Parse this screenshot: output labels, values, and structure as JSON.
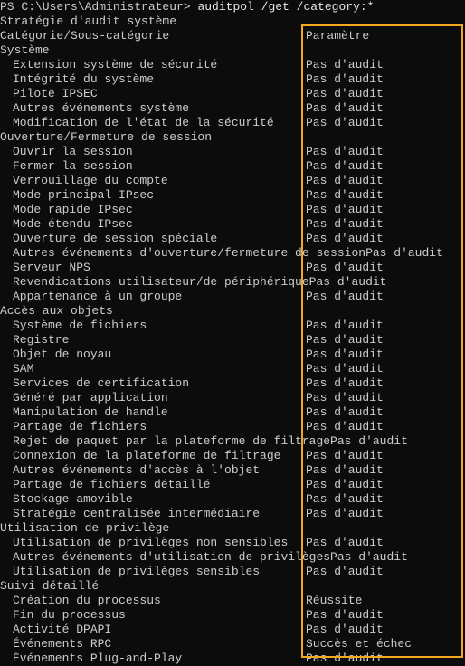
{
  "prompt_prefix": "PS C:\\Users\\Administrateur> ",
  "command": "auditpol /get /category:*",
  "header_line": "Stratégie d'audit système",
  "column_header_left": "Catégorie/Sous-catégorie",
  "column_header_right": "Paramètre",
  "categories": [
    {
      "name": "Système",
      "subs": [
        {
          "label": "Extension système de sécurité",
          "param": "Pas d'audit"
        },
        {
          "label": "Intégrité du système",
          "param": "Pas d'audit"
        },
        {
          "label": "Pilote IPSEC",
          "param": "Pas d'audit"
        },
        {
          "label": "Autres événements système",
          "param": "Pas d'audit"
        },
        {
          "label": "Modification de l'état de la sécurité",
          "param": "Pas d'audit"
        }
      ]
    },
    {
      "name": "Ouverture/Fermeture de session",
      "subs": [
        {
          "label": "Ouvrir la session",
          "param": "Pas d'audit"
        },
        {
          "label": "Fermer la session",
          "param": "Pas d'audit"
        },
        {
          "label": "Verrouillage du compte",
          "param": "Pas d'audit"
        },
        {
          "label": "Mode principal IPsec",
          "param": "Pas d'audit"
        },
        {
          "label": "Mode rapide IPsec",
          "param": "Pas d'audit"
        },
        {
          "label": "Mode étendu IPsec",
          "param": "Pas d'audit"
        },
        {
          "label": "Ouverture de session spéciale",
          "param": "Pas d'audit"
        },
        {
          "label": "Autres événements d'ouverture/fermeture de sessionPas d'audit",
          "param": "",
          "overflow": true
        },
        {
          "label": "Serveur NPS",
          "param": "Pas d'audit"
        },
        {
          "label": "Revendications utilisateur/de périphériquePas d'audit",
          "param": "",
          "overflow": true
        },
        {
          "label": "Appartenance à un groupe",
          "param": "Pas d'audit"
        }
      ]
    },
    {
      "name": "Accès aux objets",
      "subs": [
        {
          "label": "Système de fichiers",
          "param": "Pas d'audit"
        },
        {
          "label": "Registre",
          "param": "Pas d'audit"
        },
        {
          "label": "Objet de noyau",
          "param": "Pas d'audit"
        },
        {
          "label": "SAM",
          "param": "Pas d'audit"
        },
        {
          "label": "Services de certification",
          "param": "Pas d'audit"
        },
        {
          "label": "Généré par application",
          "param": "Pas d'audit"
        },
        {
          "label": "Manipulation de handle",
          "param": "Pas d'audit"
        },
        {
          "label": "Partage de fichiers",
          "param": "Pas d'audit"
        },
        {
          "label": "Rejet de paquet par la plateforme de filtragePas d'audit",
          "param": "",
          "overflow": true
        },
        {
          "label": "Connexion de la plateforme de filtrage",
          "param": "Pas d'audit"
        },
        {
          "label": "Autres événements d'accès à l'objet",
          "param": "Pas d'audit"
        },
        {
          "label": "Partage de fichiers détaillé",
          "param": "Pas d'audit"
        },
        {
          "label": "Stockage amovible",
          "param": "Pas d'audit"
        },
        {
          "label": "Stratégie centralisée intermédiaire",
          "param": "Pas d'audit"
        }
      ]
    },
    {
      "name": "Utilisation de privilège",
      "subs": [
        {
          "label": "Utilisation de privilèges non sensibles",
          "param": "Pas d'audit"
        },
        {
          "label": "Autres événements d'utilisation de privilègesPas d'audit",
          "param": "",
          "overflow": true
        },
        {
          "label": "Utilisation de privilèges sensibles",
          "param": "Pas d'audit"
        }
      ]
    },
    {
      "name": "Suivi détaillé",
      "subs": [
        {
          "label": "Création du processus",
          "param": "Réussite"
        },
        {
          "label": "Fin du processus",
          "param": "Pas d'audit"
        },
        {
          "label": "Activité DPAPI",
          "param": "Pas d'audit"
        },
        {
          "label": "Événements RPC",
          "param": "Succès et échec"
        },
        {
          "label": "Événements Plug-and-Play",
          "param": "Pas d'audit"
        }
      ]
    }
  ]
}
